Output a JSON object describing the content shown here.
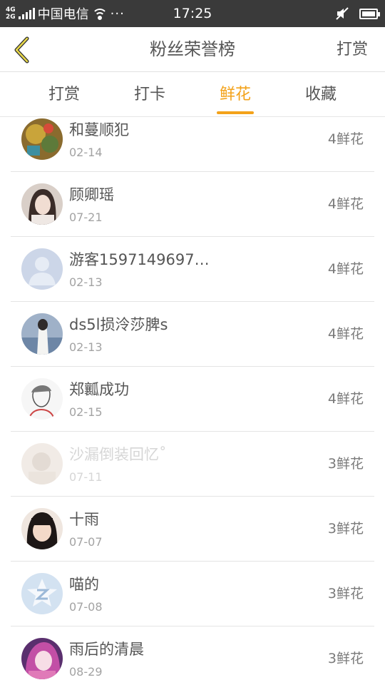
{
  "status_bar": {
    "network_top": "4G",
    "network_bottom": "2G",
    "carrier": "中国电信",
    "more": "···",
    "time": "17:25"
  },
  "nav": {
    "title": "粉丝荣誉榜",
    "right_action": "打赏"
  },
  "tabs": [
    {
      "label": "打赏",
      "active": false
    },
    {
      "label": "打卡",
      "active": false
    },
    {
      "label": "鲜花",
      "active": true
    },
    {
      "label": "收藏",
      "active": false
    }
  ],
  "accent_color": "#f3a21a",
  "list": [
    {
      "name": "和蔓顺犯",
      "date": "02-14",
      "count": "4鲜花",
      "avatar": "avatar-photo-colorful"
    },
    {
      "name": "顾卿瑶",
      "date": "07-21",
      "count": "4鲜花",
      "avatar": "avatar-photo-girl"
    },
    {
      "name": "游客1597149697…",
      "date": "02-13",
      "count": "4鲜花",
      "avatar": "default-user-avatar"
    },
    {
      "name": "ds5l损泠莎脾s",
      "date": "02-13",
      "count": "4鲜花",
      "avatar": "avatar-photo-person-outdoor"
    },
    {
      "name": "郑瓤成功",
      "date": "02-15",
      "count": "4鲜花",
      "avatar": "avatar-sketch-portrait"
    },
    {
      "name": "沙漏倒装回忆˚",
      "date": "07-11",
      "count": "3鲜花",
      "avatar": "avatar-photo-faded"
    },
    {
      "name": "十雨",
      "date": "07-07",
      "count": "3鲜花",
      "avatar": "avatar-photo-child"
    },
    {
      "name": "喵的",
      "date": "07-08",
      "count": "3鲜花",
      "avatar": "qq-default-avatar"
    },
    {
      "name": "雨后的清晨",
      "date": "08-29",
      "count": "3鲜花",
      "avatar": "avatar-anime-girl"
    }
  ]
}
